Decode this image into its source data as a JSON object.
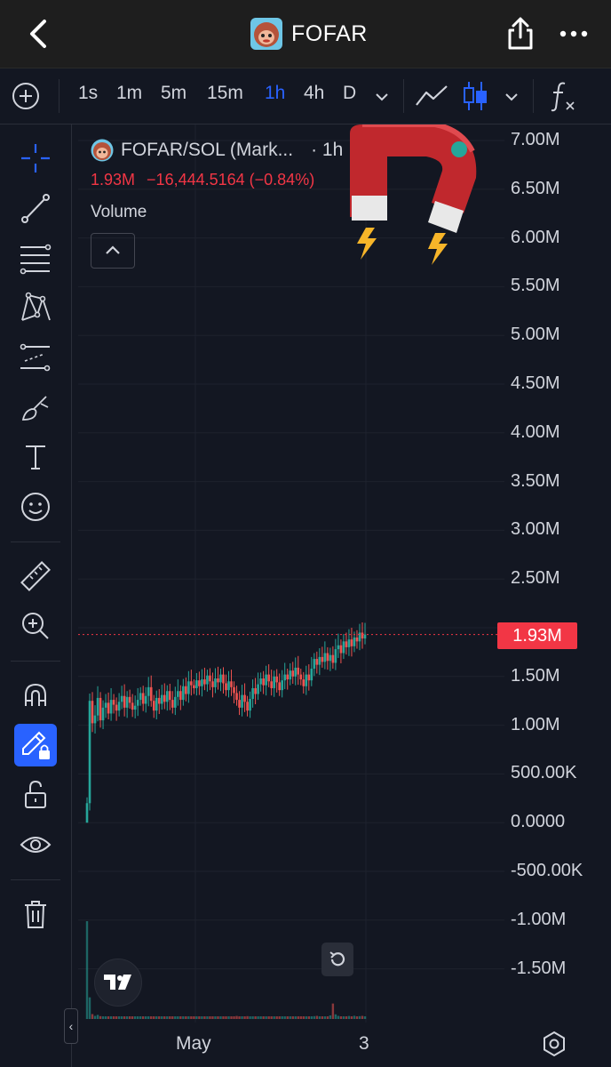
{
  "header": {
    "title": "FOFAR",
    "back_icon": "chevron-left-icon",
    "share_icon": "share-icon",
    "more_icon": "more-horizontal-icon"
  },
  "toolbar": {
    "intervals": [
      "1s",
      "1m",
      "5m",
      "15m",
      "1h",
      "4h",
      "D"
    ],
    "active_interval": "1h"
  },
  "legend": {
    "symbol": "FOFAR/SOL (Mark...",
    "interval": "· 1h · d...",
    "last_price": "1.93M",
    "change": "−16,444.5164 (−0.84%)",
    "indicator": "Volume"
  },
  "colors": {
    "up": "#26a69a",
    "down": "#ef5350",
    "price_line": "#f23645",
    "accent": "#2962ff"
  },
  "chart_data": {
    "type": "candlestick",
    "title": "FOFAR/SOL (Mark...",
    "y_ticks": [
      "7.00M",
      "6.50M",
      "6.00M",
      "5.50M",
      "5.00M",
      "4.50M",
      "4.00M",
      "3.50M",
      "3.00M",
      "2.50M",
      "1.50M",
      "1.00M",
      "500.00K",
      "0.0000",
      "-500.00K",
      "-1.00M",
      "-1.50M"
    ],
    "ylim": [
      -1750000,
      7250000
    ],
    "last_price": 1930000,
    "last_price_label": "1.93M",
    "x_ticks": [
      "May",
      "3"
    ],
    "series": [
      {
        "name": "FOFAR/SOL",
        "close": [
          200000,
          1250000,
          1020000,
          1100000,
          1280000,
          1050000,
          1180000,
          1230000,
          1120000,
          1260000,
          1210000,
          1150000,
          1240000,
          1300000,
          1180000,
          1290000,
          1230000,
          1160000,
          1200000,
          1260000,
          1330000,
          1220000,
          1300000,
          1390000,
          1250000,
          1150000,
          1280000,
          1220000,
          1310000,
          1240000,
          1350000,
          1260000,
          1180000,
          1290000,
          1350000,
          1260000,
          1400000,
          1320000,
          1450000,
          1410000,
          1380000,
          1460000,
          1400000,
          1470000,
          1420000,
          1510000,
          1450000,
          1390000,
          1480000,
          1440000,
          1520000,
          1430000,
          1360000,
          1450000,
          1390000,
          1330000,
          1260000,
          1180000,
          1310000,
          1240000,
          1150000,
          1270000,
          1380000,
          1320000,
          1420000,
          1480000,
          1410000,
          1520000,
          1450000,
          1380000,
          1500000,
          1440000,
          1360000,
          1460000,
          1520000,
          1470000,
          1560000,
          1500000,
          1590000,
          1520000,
          1470000,
          1400000,
          1520000,
          1460000,
          1580000,
          1680000,
          1620000,
          1700000,
          1650000,
          1740000,
          1660000,
          1720000,
          1640000,
          1780000,
          1820000,
          1740000,
          1860000,
          1800000,
          1880000,
          1810000,
          1900000,
          1860000,
          1950000,
          1890000,
          1930000
        ]
      }
    ],
    "volume": [
      1900000,
      420000,
      95000,
      60000,
      80000,
      55000,
      50000,
      48000,
      45000,
      52000,
      40000,
      45000,
      38000,
      42000,
      40000,
      36000,
      44000,
      38000,
      41000,
      35000,
      47000,
      39000,
      43000,
      36000,
      50000,
      42000,
      38000,
      45000,
      40000,
      43000,
      37000,
      41000,
      46000,
      38000,
      42000,
      36000,
      40000,
      44000,
      38000,
      42000,
      35000,
      45000,
      39000,
      41000,
      37000,
      43000,
      40000,
      46000,
      38000,
      42000,
      36000,
      40000,
      48000,
      44000,
      52000,
      46000,
      58000,
      50000,
      42000,
      47000,
      55000,
      44000,
      40000,
      46000,
      38000,
      41000,
      43000,
      39000,
      45000,
      48000,
      40000,
      42000,
      50000,
      44000,
      39000,
      46000,
      41000,
      45000,
      38000,
      43000,
      47000,
      52000,
      44000,
      48000,
      40000,
      55000,
      60000,
      48000,
      42000,
      46000,
      44000,
      70000,
      300000,
      90000,
      60000,
      48000,
      52000,
      45000,
      58000,
      50000,
      62000,
      48000,
      55000,
      60000,
      52000
    ]
  }
}
